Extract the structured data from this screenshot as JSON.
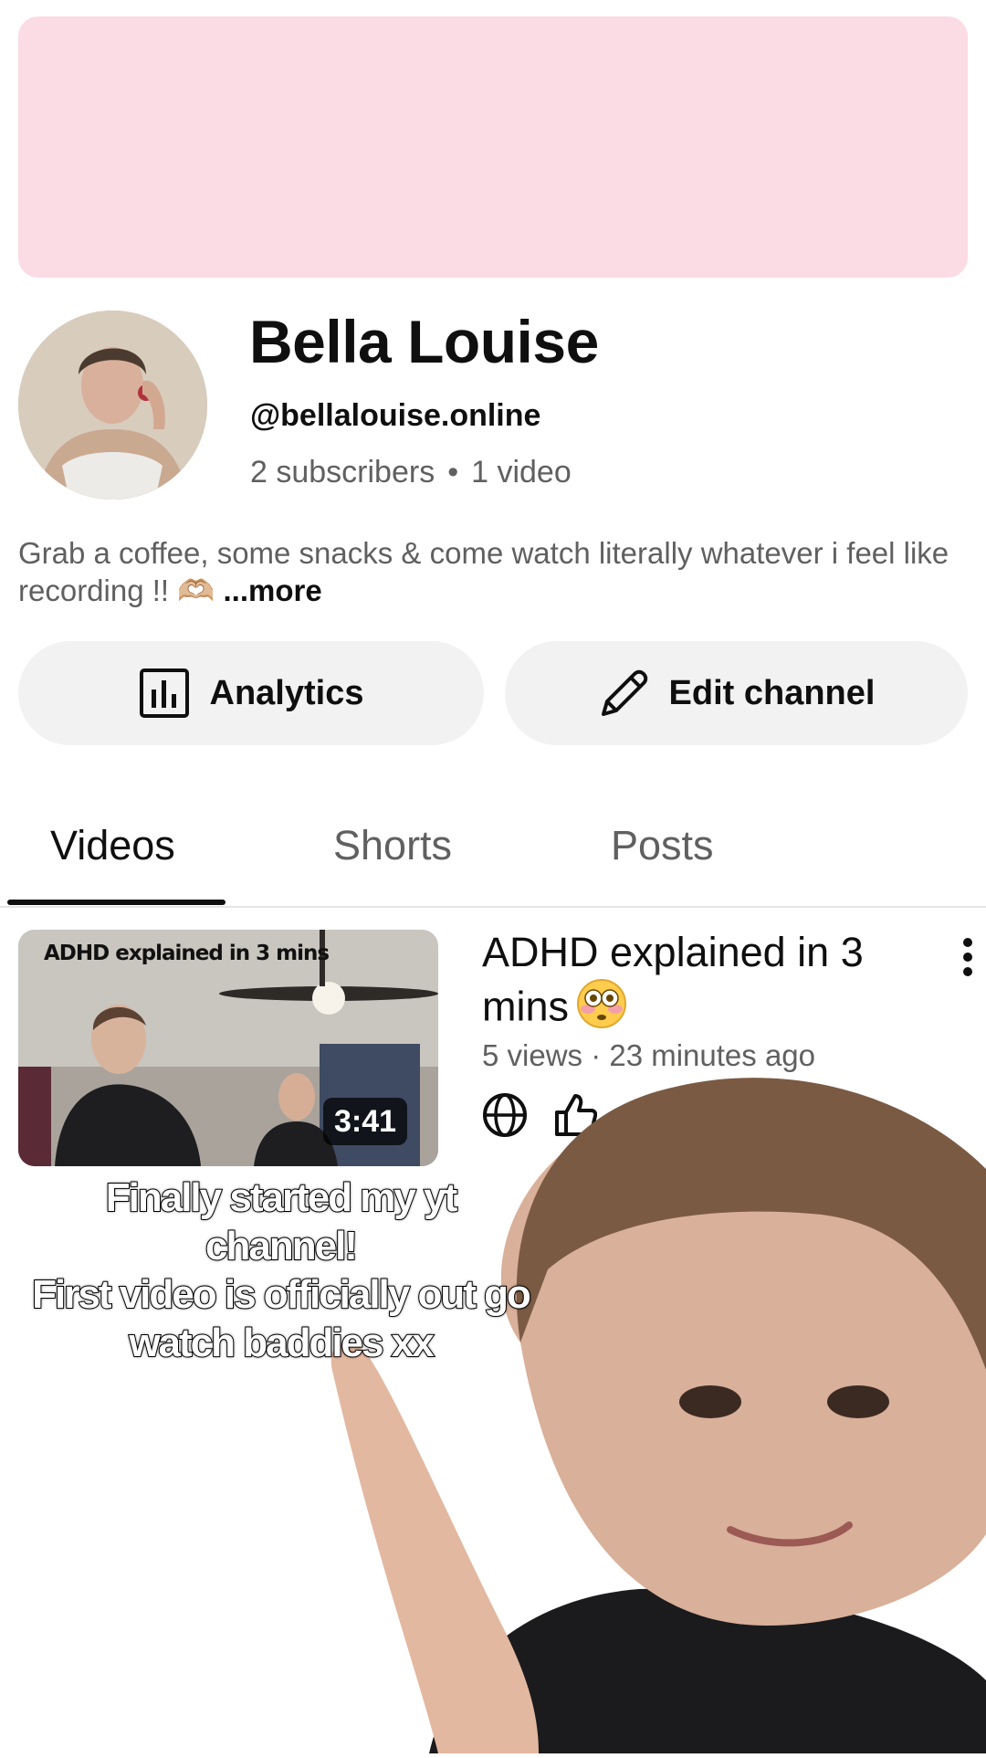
{
  "banner": {
    "color": "#fbdbe4"
  },
  "channel": {
    "name": "Bella Louise",
    "handle": "@bellalouise.online",
    "subscribers": "2 subscribers",
    "separator": "•",
    "videos": "1 video",
    "description": "Grab a coffee, some snacks & come watch literally whatever i feel like recording !! 🫶🏼",
    "more_label": "...more"
  },
  "actions": {
    "analytics_label": "Analytics",
    "analytics_icon": "bar-chart-icon",
    "edit_label": "Edit channel",
    "edit_icon": "pencil-icon"
  },
  "tabs": [
    {
      "label": "Videos",
      "active": true
    },
    {
      "label": "Shorts",
      "active": false
    },
    {
      "label": "Posts",
      "active": false
    }
  ],
  "video": {
    "thumbnail_text": "ADHD explained in 3 mins",
    "duration": "3:41",
    "title": "ADHD explained in 3 mins",
    "title_emoji": "flushed-face",
    "meta": "5 views · 23 minutes ago",
    "visibility_icon": "globe-icon",
    "like_icon": "thumbs-up-icon"
  },
  "overlay": {
    "caption": "Finally started my yt channel!\nFirst video is officially out go watch baddies xx"
  }
}
